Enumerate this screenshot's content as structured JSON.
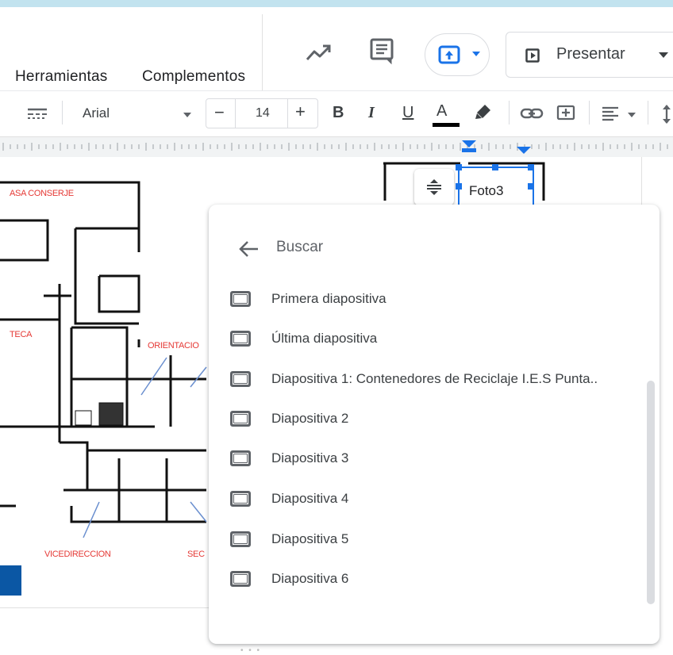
{
  "menu": {
    "items": [
      "Herramientas",
      "Complementos"
    ]
  },
  "header": {
    "present_label": "Presentar",
    "icons": [
      "trending-icon",
      "comment-icon",
      "insert-link-icon",
      "chevron-down-icon",
      "slideshow-icon"
    ]
  },
  "toolbar": {
    "font": "Arial",
    "font_size": "14",
    "minus": "−",
    "plus": "+",
    "bold": "B",
    "italic": "I",
    "underline": "U",
    "text_color": "A"
  },
  "slide": {
    "labels": {
      "casa": "ASA CONSERJE",
      "teca": "TECA",
      "orientacion": "ORIENTACIO",
      "vicedireccion": "VICEDIRECCION",
      "sec": "SEC"
    },
    "selected_element": "Foto3"
  },
  "link_panel": {
    "search_label": "Buscar",
    "items": [
      {
        "label": "Primera diapositiva"
      },
      {
        "label": "Última diapositiva"
      },
      {
        "label": "Diapositiva 1: Contenedores de Reciclaje I.E.S Punta.."
      },
      {
        "label": "Diapositiva 2"
      },
      {
        "label": "Diapositiva 3"
      },
      {
        "label": "Diapositiva 4"
      },
      {
        "label": "Diapositiva 5"
      },
      {
        "label": "Diapositiva 6"
      }
    ]
  },
  "colors": {
    "accent": "#1a73e8",
    "topstrip": "#c2e3ef",
    "plan_red": "#e53935",
    "blue_bar": "#0b57a4"
  }
}
